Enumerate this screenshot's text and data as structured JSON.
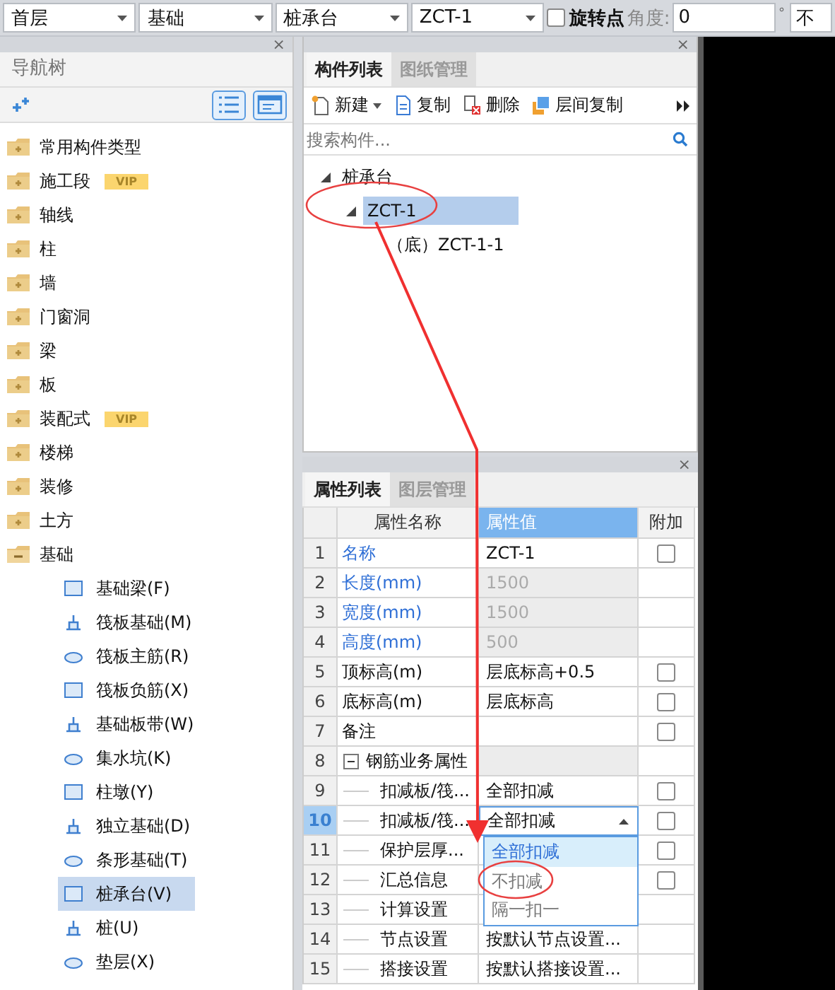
{
  "top_bar": {
    "selectors": [
      {
        "value": "首层"
      },
      {
        "value": "基础"
      },
      {
        "value": "桩承台"
      },
      {
        "value": "ZCT-1"
      }
    ],
    "rotate_point": {
      "label": "旋转点",
      "checked": false
    },
    "angle": {
      "label": "角度:",
      "value": "0",
      "unit": "°"
    },
    "offset_selector": {
      "value": "不"
    }
  },
  "nav_panel": {
    "close": "×",
    "title": "导航树",
    "items": [
      {
        "label": "常用构件类型",
        "expanded": false,
        "selected": false
      },
      {
        "label": "施工段",
        "badge": "VIP",
        "expanded": false,
        "selected": false
      },
      {
        "label": "轴线",
        "expanded": false,
        "selected": false
      },
      {
        "label": "柱",
        "expanded": false,
        "selected": false
      },
      {
        "label": "墙",
        "expanded": false,
        "selected": false
      },
      {
        "label": "门窗洞",
        "expanded": false,
        "selected": false
      },
      {
        "label": "梁",
        "expanded": false,
        "selected": false
      },
      {
        "label": "板",
        "expanded": false,
        "selected": false
      },
      {
        "label": "装配式",
        "badge": "VIP",
        "expanded": false,
        "selected": false
      },
      {
        "label": "楼梯",
        "expanded": false,
        "selected": false
      },
      {
        "label": "装修",
        "expanded": false,
        "selected": false
      },
      {
        "label": "土方",
        "expanded": false,
        "selected": false
      },
      {
        "label": "基础",
        "expanded": true,
        "selected": false,
        "children": [
          {
            "label": "基础梁(F)",
            "selected": false
          },
          {
            "label": "筏板基础(M)",
            "selected": false
          },
          {
            "label": "筏板主筋(R)",
            "selected": false
          },
          {
            "label": "筏板负筋(X)",
            "selected": false
          },
          {
            "label": "基础板带(W)",
            "selected": false
          },
          {
            "label": "集水坑(K)",
            "selected": false
          },
          {
            "label": "柱墩(Y)",
            "selected": false
          },
          {
            "label": "独立基础(D)",
            "selected": false
          },
          {
            "label": "条形基础(T)",
            "selected": false
          },
          {
            "label": "桩承台(V)",
            "selected": true
          },
          {
            "label": "桩(U)",
            "selected": false
          },
          {
            "label": "垫层(X)",
            "selected": false
          }
        ]
      }
    ]
  },
  "component_panel": {
    "close": "×",
    "tabs": [
      {
        "label": "构件列表",
        "selected": true
      },
      {
        "label": "图纸管理",
        "selected": false
      }
    ],
    "actions": [
      {
        "label": "新建",
        "kind": "new",
        "has_menu": true
      },
      {
        "label": "复制",
        "kind": "copy",
        "has_menu": false
      },
      {
        "label": "删除",
        "kind": "delete",
        "has_menu": false
      },
      {
        "label": "层间复制",
        "kind": "floor_copy",
        "has_menu": false
      }
    ],
    "search": {
      "placeholder": "搜索构件..."
    },
    "tree": [
      {
        "label": "桩承台",
        "expanded": true,
        "selected": false,
        "children": [
          {
            "label": "ZCT-1",
            "expanded": true,
            "selected": true,
            "children": [
              {
                "label": "（底）ZCT-1-1",
                "selected": false
              }
            ]
          }
        ]
      }
    ]
  },
  "property_panel": {
    "close": "×",
    "tabs": [
      {
        "label": "属性列表",
        "selected": true
      },
      {
        "label": "图层管理",
        "selected": false
      }
    ],
    "columns": [
      "属性名称",
      "属性值",
      "附加"
    ],
    "rows": [
      {
        "num": "1",
        "kind": "field",
        "name": "名称",
        "value": "ZCT-1",
        "public": true,
        "readonly": false,
        "attach": false,
        "selected": false
      },
      {
        "num": "2",
        "kind": "field",
        "name": "长度(mm)",
        "value": "1500",
        "public": true,
        "readonly": true,
        "selected": false
      },
      {
        "num": "3",
        "kind": "field",
        "name": "宽度(mm)",
        "value": "1500",
        "public": true,
        "readonly": true,
        "selected": false
      },
      {
        "num": "4",
        "kind": "field",
        "name": "高度(mm)",
        "value": "500",
        "public": true,
        "readonly": true,
        "selected": false
      },
      {
        "num": "5",
        "kind": "field",
        "name": "顶标高(m)",
        "value": "层底标高+0.5",
        "public": false,
        "readonly": false,
        "attach": false,
        "selected": false
      },
      {
        "num": "6",
        "kind": "field",
        "name": "底标高(m)",
        "value": "层底标高",
        "public": false,
        "readonly": false,
        "attach": false,
        "selected": false
      },
      {
        "num": "7",
        "kind": "field",
        "name": "备注",
        "public": false,
        "readonly": false,
        "attach": false,
        "selected": false
      },
      {
        "num": "8",
        "kind": "group",
        "name": "钢筋业务属性",
        "expanded": true,
        "selected": false
      },
      {
        "num": "9",
        "kind": "child",
        "name": "扣减板/筏...",
        "value": "全部扣减",
        "attach": false,
        "selected": false
      },
      {
        "num": "10",
        "kind": "child",
        "name": "扣减板/筏...",
        "value": "全部扣减",
        "open": true,
        "attach": false,
        "selected": true
      },
      {
        "num": "11",
        "kind": "child",
        "name": "保护层厚...",
        "attach": false,
        "selected": false
      },
      {
        "num": "12",
        "kind": "child",
        "name": "汇总信息",
        "attach": false,
        "selected": false
      },
      {
        "num": "13",
        "kind": "child",
        "name": "计算设置",
        "selected": false
      },
      {
        "num": "14",
        "kind": "child",
        "name": "节点设置",
        "value": "按默认节点设置...",
        "selected": false
      },
      {
        "num": "15",
        "kind": "child",
        "name": "搭接设置",
        "value": "按默认搭接设置...",
        "selected": false
      }
    ],
    "dropdown": {
      "options": [
        {
          "label": "全部扣减",
          "selected": true
        },
        {
          "label": "不扣减",
          "selected": false
        },
        {
          "label": "隔一扣一",
          "selected": false
        }
      ]
    }
  }
}
